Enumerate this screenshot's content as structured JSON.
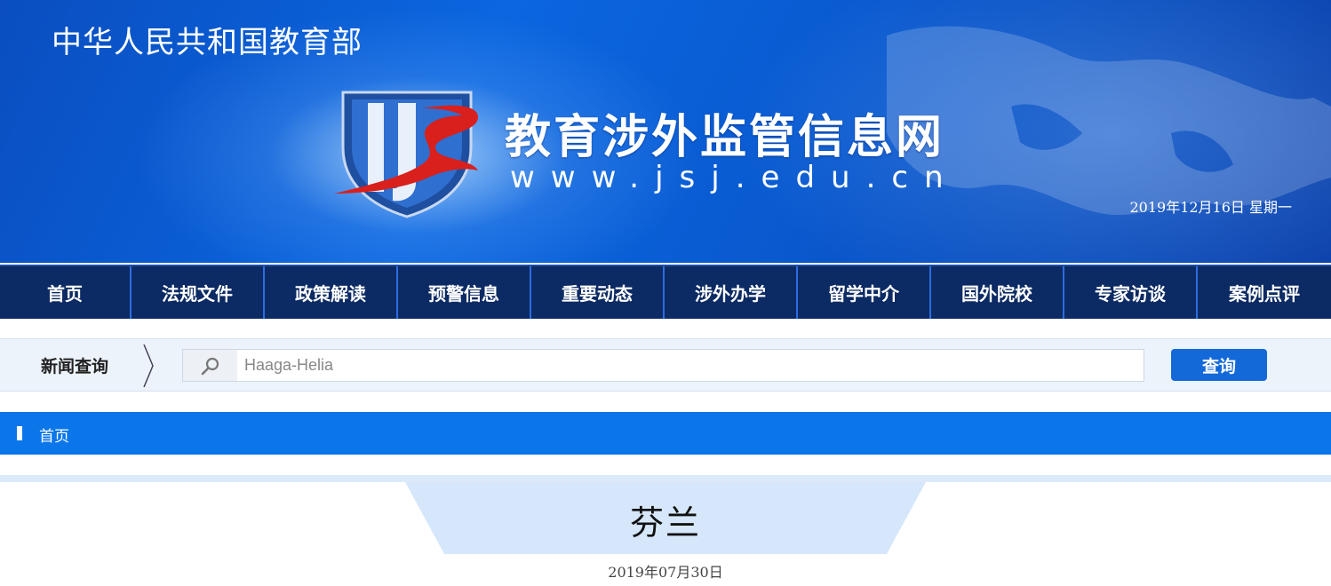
{
  "header": {
    "ministry_title": "中华人民共和国教育部",
    "site_name": "教育涉外监管信息网",
    "site_url": "www.jsj.edu.cn",
    "date": "2019年12月16日  星期一"
  },
  "nav": {
    "items": [
      {
        "label": "首页"
      },
      {
        "label": "法规文件"
      },
      {
        "label": "政策解读"
      },
      {
        "label": "预警信息"
      },
      {
        "label": "重要动态"
      },
      {
        "label": "涉外办学"
      },
      {
        "label": "留学中介"
      },
      {
        "label": "国外院校"
      },
      {
        "label": "专家访谈"
      },
      {
        "label": "案例点评"
      }
    ]
  },
  "search": {
    "label": "新闻查询",
    "value": "Haaga-Helia",
    "button_label": "查询",
    "icon": "magnifier-icon"
  },
  "breadcrumb": {
    "home": "首页"
  },
  "article": {
    "title": "芬兰",
    "date": "2019年07月30日"
  },
  "colors": {
    "nav_bg": "#0c2a63",
    "accent_blue": "#0a76ea",
    "button_blue": "#1469d8",
    "logo_red": "#d9201c"
  }
}
